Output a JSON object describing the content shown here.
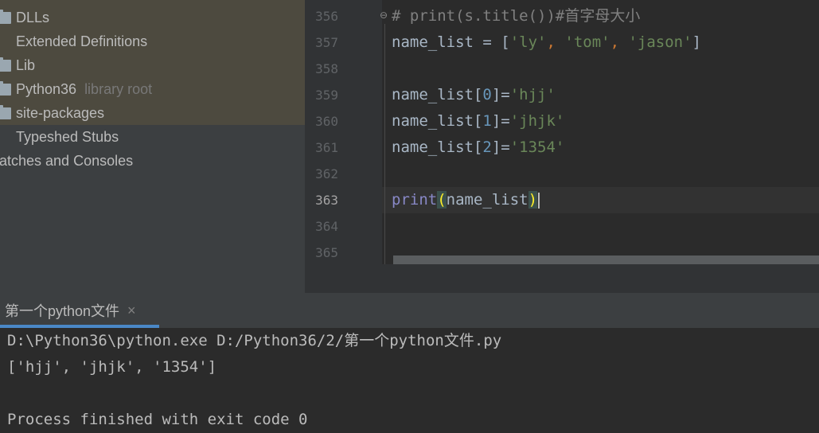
{
  "project_tree": {
    "items": [
      {
        "label": "DLLs",
        "icon": "folder-icon",
        "hint": ""
      },
      {
        "label": "Extended Definitions",
        "icon": "library-icon",
        "hint": ""
      },
      {
        "label": "Lib",
        "icon": "folder-icon",
        "hint": ""
      },
      {
        "label": "Python36",
        "icon": "folder-icon",
        "hint": "library root"
      },
      {
        "label": "site-packages",
        "icon": "folder-icon",
        "hint": ""
      },
      {
        "label": "Typeshed Stubs",
        "icon": "library-icon",
        "hint": ""
      },
      {
        "label": "atches and Consoles",
        "icon": "",
        "hint": ""
      }
    ]
  },
  "editor": {
    "line_numbers": [
      "356",
      "357",
      "358",
      "359",
      "360",
      "361",
      "362",
      "363",
      "364",
      "365"
    ],
    "current_line": "363",
    "lines": {
      "l356": "# print(s.title())#首字母大小",
      "l357": {
        "a": "name_list = [",
        "s1": "'ly'",
        "c1": ", ",
        "s2": "'tom'",
        "c2": ", ",
        "s3": "'jason'",
        "b": "]"
      },
      "l359": {
        "a": "name_list[",
        "n": "0",
        "b": "]=",
        "s": "'hjj'"
      },
      "l360": {
        "a": "name_list[",
        "n": "1",
        "b": "]=",
        "s": "'jhjk'"
      },
      "l361": {
        "a": "name_list[",
        "n": "2",
        "b": "]=",
        "s": "'1354'"
      },
      "l363": {
        "fn": "print",
        "open": "(",
        "arg": "name_list",
        "close": ")"
      }
    }
  },
  "run_panel": {
    "tab_label": "第一个python文件",
    "close_glyph": "×",
    "console": [
      "D:\\Python36\\python.exe D:/Python36/2/第一个python文件.py",
      "['hjj', 'jhjk', '1354']",
      "",
      "Process finished with exit code 0"
    ]
  },
  "colors": {
    "comment": "#808080",
    "string": "#6a8759",
    "number": "#6897bb",
    "builtin": "#8888c6",
    "brace_match": "#ffef28",
    "tab_underline": "#4a88c7"
  }
}
